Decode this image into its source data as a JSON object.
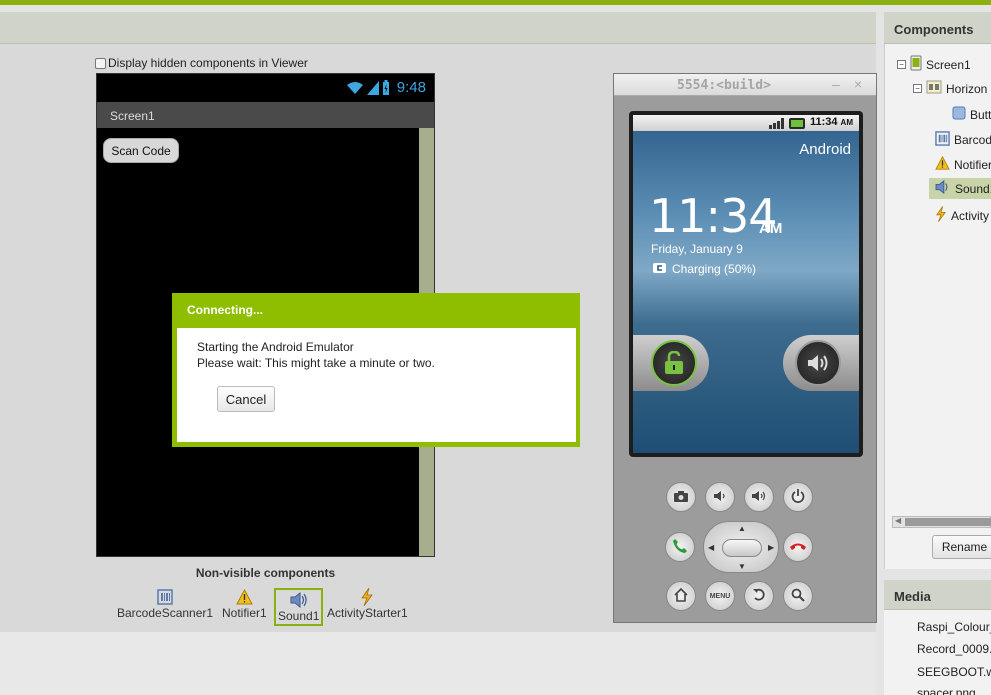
{
  "viewer": {
    "hidden_toggle_label": "Display hidden components in Viewer",
    "phone": {
      "time": "9:48",
      "screen_title": "Screen1",
      "scan_button_label": "Scan Code"
    },
    "nonvisible": {
      "title": "Non-visible components",
      "items": [
        {
          "label": "BarcodeScanner1",
          "icon": "barcode-icon"
        },
        {
          "label": "Notifier1",
          "icon": "warning-icon"
        },
        {
          "label": "Sound1",
          "icon": "speaker-icon"
        },
        {
          "label": "ActivityStarter1",
          "icon": "lightning-icon"
        }
      ]
    }
  },
  "dialog": {
    "title": "Connecting...",
    "line1": "Starting the Android Emulator",
    "line2": "Please wait: This might take a minute or two.",
    "cancel_label": "Cancel"
  },
  "emulator": {
    "window_title": "5554:<build>",
    "minimize_glyph": "–",
    "close_glyph": "×",
    "status_time": "11:34",
    "status_ampm": "AM",
    "brand": "Android",
    "clock": "11:34",
    "clock_ampm": "AM",
    "date": "Friday, January 9",
    "charging": "Charging (50%)",
    "menu_label": "MENU",
    "accent_color": "#7bc243"
  },
  "components_panel": {
    "title": "Components",
    "tree": [
      {
        "label": "Screen1",
        "expander": "⊟"
      },
      {
        "label": "Horizon",
        "expander": "⊟"
      },
      {
        "label": "Butt"
      },
      {
        "label": "Barcod"
      },
      {
        "label": "Notifier"
      },
      {
        "label": "Sound1",
        "selected": true
      },
      {
        "label": "Activity"
      }
    ],
    "rename_label": "Rename"
  },
  "media_panel": {
    "title": "Media",
    "items": [
      "Raspi_Colour_",
      "Record_0009.",
      "SEEGBOOT.w",
      "spacer.png"
    ]
  },
  "colors": {
    "brand_green": "#8cb010",
    "dialog_green": "#8fbe00"
  }
}
